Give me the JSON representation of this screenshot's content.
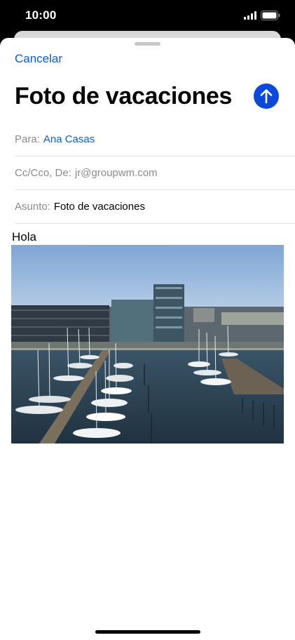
{
  "status_bar": {
    "time": "10:00",
    "icons": [
      "signal-icon",
      "battery-icon"
    ]
  },
  "compose": {
    "cancel_label": "Cancelar",
    "title": "Foto de vacaciones",
    "send_icon": "arrow-up-icon",
    "accent_color": "#0a49d9"
  },
  "fields": {
    "to_label": "Para:",
    "to_value": "Ana Casas",
    "cc_label": "Cc/Cco, De:",
    "cc_value": "jr@groupwm.com",
    "subject_label": "Asunto:",
    "subject_value": "Foto de vacaciones"
  },
  "body": {
    "text": "Hola",
    "attachment": "harbor-photo"
  }
}
